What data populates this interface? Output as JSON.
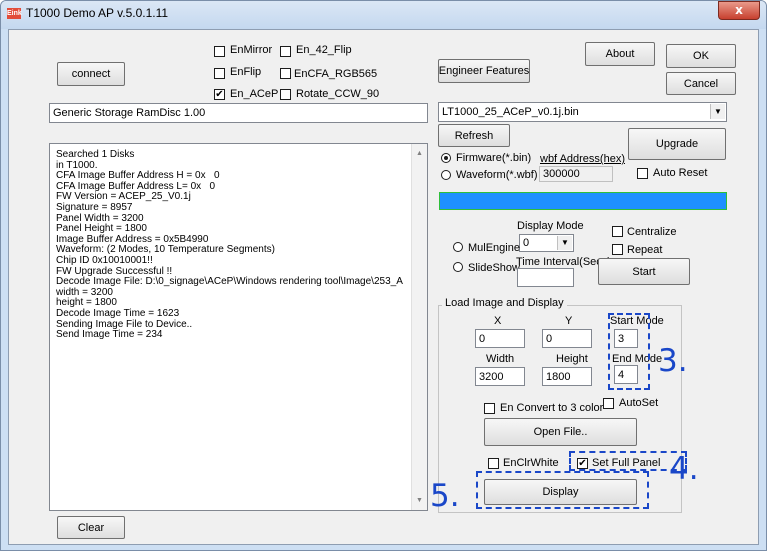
{
  "window": {
    "title": "T1000 Demo AP v.5.0.1.11",
    "icon_text": "Eink",
    "close_glyph": "x"
  },
  "buttons": {
    "connect": "connect",
    "engineer_features": "Engineer Features",
    "about": "About",
    "ok": "OK",
    "cancel": "Cancel",
    "refresh": "Refresh",
    "upgrade": "Upgrade",
    "start": "Start",
    "open_file": "Open File..",
    "display": "Display",
    "clear": "Clear"
  },
  "options": {
    "en_mirror": {
      "label": "EnMirror",
      "checked": false
    },
    "en_42_flip": {
      "label": "En_42_Flip",
      "checked": false
    },
    "en_flip": {
      "label": "EnFlip",
      "checked": false
    },
    "en_cfa_rgb565": {
      "label": "EnCFA_RGB565",
      "checked": false
    },
    "en_acep": {
      "label": "En_ACeP",
      "checked": true
    },
    "rotate_ccw_90": {
      "label": "Rotate_CCW_90",
      "checked": false
    }
  },
  "device_field": "Generic Storage RamDisc 1.00",
  "firmware_select": "LT1000_25_ACeP_v0.1j.bin",
  "firmware_radio": {
    "label": "Firmware(*.bin)",
    "selected": true
  },
  "waveform_radio": {
    "label": "Waveform(*.wbf)",
    "selected": false
  },
  "wbf_address": {
    "label": "wbf Address(hex)",
    "value": "300000"
  },
  "auto_reset": {
    "label": "Auto Reset",
    "checked": false
  },
  "progress": {
    "value": 100,
    "color": "#1e90ff"
  },
  "display_mode": {
    "label": "Display Mode",
    "value": "0"
  },
  "mul_engine": {
    "label": "MulEngine",
    "selected": false
  },
  "slide_show": {
    "label": "SlideShow",
    "selected": false
  },
  "time_interval": {
    "label": "Time Interval(Secs)",
    "value": ""
  },
  "centralize": {
    "label": "Centralize",
    "checked": false
  },
  "repeat": {
    "label": "Repeat",
    "checked": false
  },
  "load_image": {
    "group_title": "Load Image and Display",
    "x_label": "X",
    "x_value": "0",
    "y_label": "Y",
    "y_value": "0",
    "start_mode_label": "Start Mode",
    "start_mode_value": "3",
    "width_label": "Width",
    "width_value": "3200",
    "height_label": "Height",
    "height_value": "1800",
    "end_mode_label": "End Mode",
    "end_mode_value": "4",
    "convert_3_color": {
      "label": "En Convert to 3 color",
      "checked": false
    },
    "auto_set": {
      "label": "AutoSet",
      "checked": false
    },
    "en_clr_white": {
      "label": "EnClrWhite",
      "checked": false
    },
    "set_full_panel": {
      "label": "Set Full Panel",
      "checked": true
    }
  },
  "annotations": {
    "step3": "3.",
    "step4": "4.",
    "step5": "5.",
    "color": "#1a47c8"
  },
  "log_lines": [
    "Searched 1 Disks",
    "in T1000.",
    "CFA Image Buffer Address H = 0x   0",
    "CFA Image Buffer Address L= 0x   0",
    "FW Version = ACEP_25_V0.1j",
    "Signature = 8957",
    "Panel Width = 3200",
    "Panel Height = 1800",
    "Image Buffer Address = 0x5B4990",
    "Waveform: (2 Modes, 10 Temperature Segments)",
    "Chip ID 0x10010001!!",
    "FW Upgrade Successful !!",
    "Decode Image File: D:\\0_signage\\ACeP\\Windows rendering tool\\Image\\253_A",
    "width = 3200",
    "height = 1800",
    "Decode Image Time = 1623",
    "Sending Image File to Device..",
    "Send Image Time = 234"
  ]
}
